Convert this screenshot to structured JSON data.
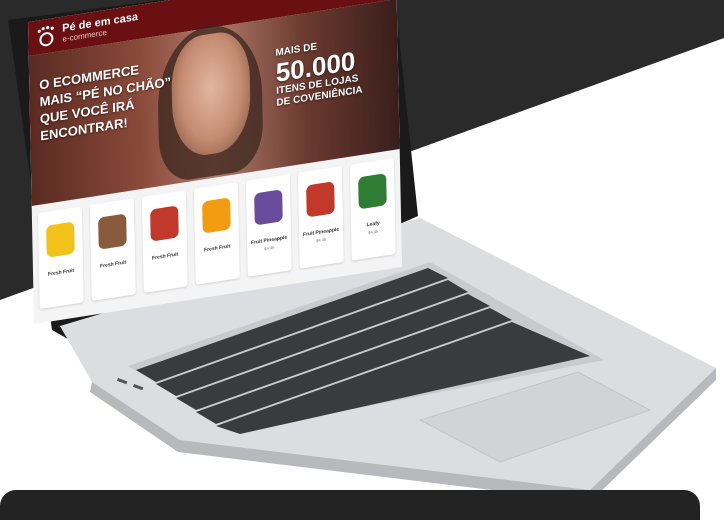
{
  "brand": {
    "name": "Pé de em casa",
    "tagline": "e-commerce",
    "color": "#6a0f12"
  },
  "hero": {
    "left_lines": [
      "O ECOMMERCE",
      "MAIS “PÉ NO CHÃO”",
      "QUE VOCÊ IRÁ",
      "ENCONTRAR!"
    ],
    "right_top": "MAIS DE",
    "right_number": "50.000",
    "right_lines": [
      "ITENS DE LOJAS",
      "DE COVENIÊNCIA"
    ]
  },
  "products": [
    {
      "name": "Fresh Fruit",
      "price": "",
      "color": "#f2c21b"
    },
    {
      "name": "Fresh Fruit",
      "price": "",
      "color": "#8a5a3c"
    },
    {
      "name": "Fresh Fruit",
      "price": "",
      "color": "#c0392b"
    },
    {
      "name": "Fresh Fruit",
      "price": "",
      "color": "#f39c12"
    },
    {
      "name": "Fruit Pineapple",
      "price": "$4.45",
      "color": "#6a4c9c"
    },
    {
      "name": "Fruit Pineapple",
      "price": "$4.45",
      "color": "#c0392b"
    },
    {
      "name": "Leafy",
      "price": "$4.45",
      "color": "#2e7d32"
    }
  ],
  "colors": {
    "background_dark": "#2a2a2a",
    "laptop_body": "#d9dadc",
    "keys": "#3a3b3d"
  }
}
